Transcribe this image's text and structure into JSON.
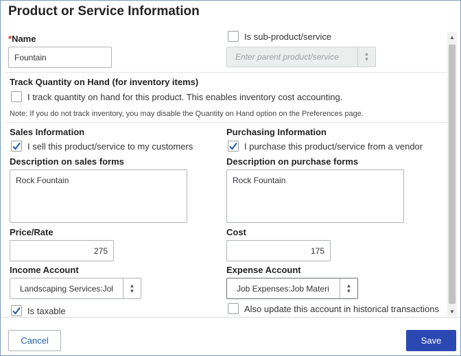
{
  "dialog": {
    "title": "Product or Service Information"
  },
  "name_section": {
    "required_mark": "*",
    "name_label": "Name",
    "name_value": "Fountain",
    "sub_product_label": "Is sub-product/service",
    "sub_product_checked": false,
    "parent_placeholder": "Enter parent product/service"
  },
  "inventory": {
    "heading": "Track Quantity on Hand (for inventory items)",
    "track_label": "I track quantity on hand for this product. This enables inventory cost accounting.",
    "track_checked": false,
    "note": "Note: If you do not track inventory, you may disable the Quantity on Hand option on the Preferences page."
  },
  "sales": {
    "heading": "Sales Information",
    "sell_label": "I sell this product/service to my customers",
    "sell_checked": true,
    "desc_label": "Description on sales forms",
    "desc_value": "Rock Fountain",
    "price_label": "Price/Rate",
    "price_value": "275",
    "account_label": "Income Account",
    "account_value": "Landscaping Services:Jol",
    "taxable_label": "Is taxable",
    "taxable_checked": true
  },
  "purchasing": {
    "heading": "Purchasing Information",
    "purchase_label": "I purchase this product/service from a vendor",
    "purchase_checked": true,
    "desc_label": "Description on purchase forms",
    "desc_value": "Rock Fountain",
    "cost_label": "Cost",
    "cost_value": "175",
    "account_label": "Expense Account",
    "account_value": "Job Expenses:Job Materi",
    "update_label": "Also update this account in historical transactions",
    "update_checked": false
  },
  "footer": {
    "cancel_label": "Cancel",
    "save_label": "Save"
  },
  "colors": {
    "primary_button": "#2b48b2",
    "link_text": "#1d5fa8",
    "required": "#d52b1e",
    "checkmark": "#2a5fa8"
  }
}
